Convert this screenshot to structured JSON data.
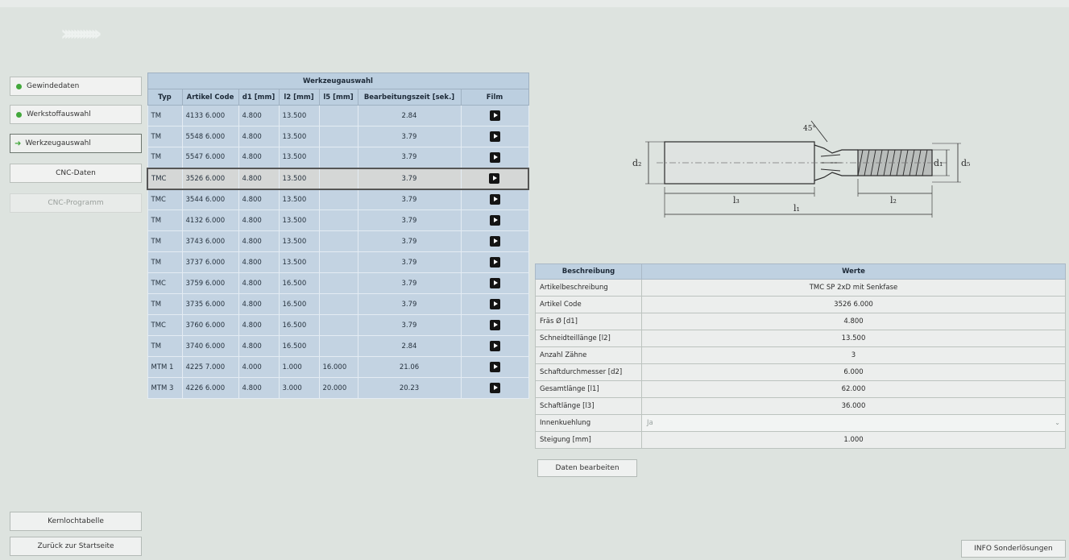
{
  "nav": {
    "items": [
      {
        "label": "Gewindedaten"
      },
      {
        "label": "Werkstoffauswahl"
      },
      {
        "label": "Werkzeugauswahl"
      },
      {
        "label": "CNC-Daten"
      },
      {
        "label": "CNC-Programm"
      }
    ]
  },
  "bottom": {
    "kernloch_label": "Kernlochtabelle",
    "back_label": "Zurück zur Startseite",
    "info_label": "INFO Sonderlösungen"
  },
  "tool_table": {
    "title": "Werkzeugauswahl",
    "headers": [
      "Typ",
      "Artikel Code",
      "d1 [mm]",
      "l2 [mm]",
      "l5 [mm]",
      "Bearbeitungszeit [sek.]",
      "Film"
    ],
    "rows": [
      [
        "TM",
        "4133 6.000",
        "4.800",
        "13.500",
        "",
        "2.84"
      ],
      [
        "TM",
        "5548 6.000",
        "4.800",
        "13.500",
        "",
        "3.79"
      ],
      [
        "TM",
        "5547 6.000",
        "4.800",
        "13.500",
        "",
        "3.79"
      ],
      [
        "TMC",
        "3526 6.000",
        "4.800",
        "13.500",
        "",
        "3.79"
      ],
      [
        "TMC",
        "3544 6.000",
        "4.800",
        "13.500",
        "",
        "3.79"
      ],
      [
        "TM",
        "4132 6.000",
        "4.800",
        "13.500",
        "",
        "3.79"
      ],
      [
        "TM",
        "3743 6.000",
        "4.800",
        "13.500",
        "",
        "3.79"
      ],
      [
        "TM",
        "3737 6.000",
        "4.800",
        "13.500",
        "",
        "3.79"
      ],
      [
        "TMC",
        "3759 6.000",
        "4.800",
        "16.500",
        "",
        "3.79"
      ],
      [
        "TM",
        "3735 6.000",
        "4.800",
        "16.500",
        "",
        "3.79"
      ],
      [
        "TMC",
        "3760 6.000",
        "4.800",
        "16.500",
        "",
        "3.79"
      ],
      [
        "TM",
        "3740 6.000",
        "4.800",
        "16.500",
        "",
        "2.84"
      ],
      [
        "MTM 1",
        "4225 7.000",
        "4.000",
        "1.000",
        "16.000",
        "21.06"
      ],
      [
        "MTM 3",
        "4226 6.000",
        "4.800",
        "3.000",
        "20.000",
        "20.23"
      ]
    ]
  },
  "drawing": {
    "labels": {
      "d2": "d₂",
      "d1": "d₁",
      "d5": "d₅",
      "l3": "l₃",
      "l2": "l₂",
      "l1": "l₁",
      "angle": "45°"
    }
  },
  "details": {
    "headers": [
      "Beschreibung",
      "Werte"
    ],
    "rows": [
      {
        "key": "Artikelbeschreibung",
        "value": "TMC SP 2xD mit Senkfase"
      },
      {
        "key": "Artikel Code",
        "value": "3526 6.000"
      },
      {
        "key": "Fräs Ø [d1]",
        "value": "4.800"
      },
      {
        "key": "Schneidteillänge [l2]",
        "value": "13.500"
      },
      {
        "key": "Anzahl Zähne",
        "value": "3"
      },
      {
        "key": "Schaftdurchmesser [d2]",
        "value": "6.000"
      },
      {
        "key": "Gesamtlänge [l1]",
        "value": "62.000"
      },
      {
        "key": "Schaftlänge [l3]",
        "value": "36.000"
      }
    ],
    "innenkuehlung": {
      "key": "Innenkuehlung",
      "value": "Ja"
    },
    "steigung": {
      "key": "Steigung [mm]",
      "value": "1.000"
    },
    "edit_label": "Daten bearbeiten"
  },
  "colors": {
    "status_ok": "#43a83c",
    "table_header": "#bccfe0",
    "table_cell": "#c3d3e2"
  },
  "selected_row_index": 3
}
